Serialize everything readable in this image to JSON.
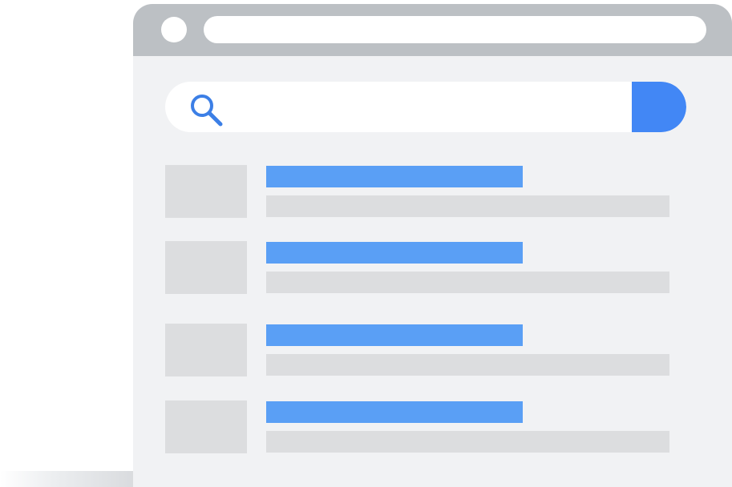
{
  "illustration": {
    "browser_window": {
      "titlebar_color": "#bcc0c4",
      "window_color": "#f1f2f4"
    },
    "search": {
      "value": "",
      "icon": "search-icon",
      "accent_color": "#4287f5"
    },
    "results": [
      {
        "title": "",
        "snippet": ""
      },
      {
        "title": "",
        "snippet": ""
      },
      {
        "title": "",
        "snippet": ""
      },
      {
        "title": "",
        "snippet": ""
      }
    ],
    "colors": {
      "result_title": "#5a9ff5",
      "placeholder_block": "#dcdddf"
    }
  }
}
